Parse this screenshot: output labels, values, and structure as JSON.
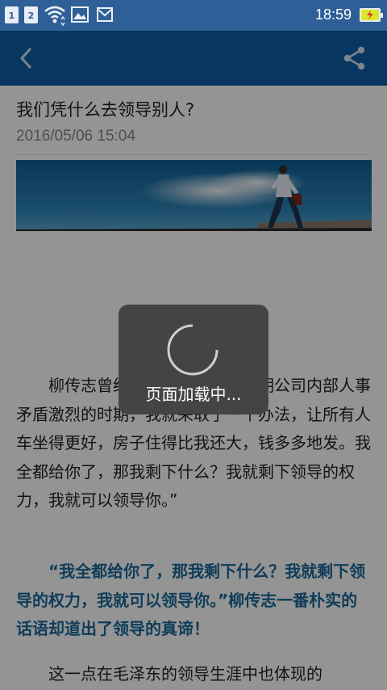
{
  "status_bar": {
    "sim1": "1",
    "sim2": "2",
    "time": "18:59",
    "icons": [
      "sim-1-icon",
      "sim-2-icon",
      "wifi-icon",
      "image-icon",
      "mail-icon",
      "battery-charging-icon"
    ],
    "bar_color": "#2f5f97"
  },
  "app_bar": {
    "color": "#0d5fa6",
    "back_icon": "back-chevron-icon",
    "share_icon": "share-icon"
  },
  "article": {
    "title": "我们凭什么去领导别人?",
    "date": "2016/05/06 15:04",
    "paragraph1": "柳传志曾经这样与人说，在早期公司内部人事矛盾激烈的时期，我就采取了一个办法，让所有人车坐得更好，房子住得比我还大，钱多多地发。我全都给你了，那我剩下什么？我就剩下领导的权力，我就可以领导你。”",
    "quote": "“我全都给你了，那我剩下什么？我就剩下领导的权力，我就可以领导你。”柳传志一番朴实的话语却道出了领导的真谛！",
    "paragraph3": "这一点在毛泽东的领导生涯中也体现的",
    "quote_color": "#1a6a9a"
  },
  "loading": {
    "text": "页面加载中..."
  }
}
